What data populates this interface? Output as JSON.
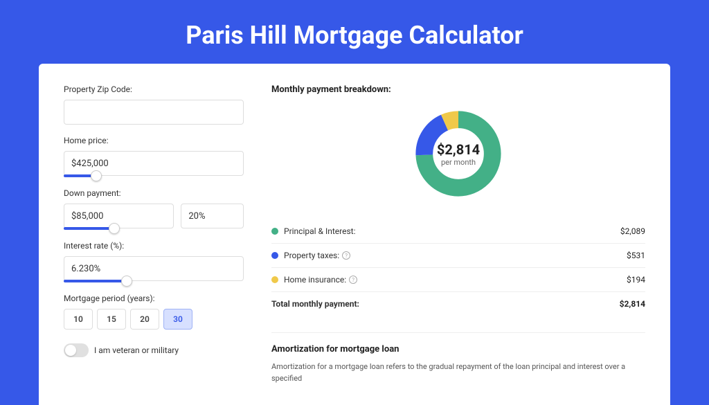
{
  "page_title": "Paris Hill Mortgage Calculator",
  "form": {
    "zip_label": "Property Zip Code:",
    "zip_value": "",
    "home_price_label": "Home price:",
    "home_price_value": "$425,000",
    "down_payment_label": "Down payment:",
    "down_payment_value": "$85,000",
    "down_payment_pct": "20%",
    "interest_label": "Interest rate (%):",
    "interest_value": "6.230%",
    "period_label": "Mortgage period (years):",
    "periods": [
      "10",
      "15",
      "20",
      "30"
    ],
    "period_selected": "30",
    "veteran_label": "I am veteran or military"
  },
  "breakdown": {
    "title": "Monthly payment breakdown:",
    "donut_value": "$2,814",
    "donut_sub": "per month",
    "rows": [
      {
        "color": "#43b087",
        "label": "Principal & Interest:",
        "value": "$2,089"
      },
      {
        "color": "#3658e8",
        "label": "Property taxes:",
        "value": "$531",
        "info": true
      },
      {
        "color": "#f0c94a",
        "label": "Home insurance:",
        "value": "$194",
        "info": true
      }
    ],
    "total_label": "Total monthly payment:",
    "total_value": "$2,814"
  },
  "amort": {
    "title": "Amortization for mortgage loan",
    "text": "Amortization for a mortgage loan refers to the gradual repayment of the loan principal and interest over a specified"
  },
  "chart_data": {
    "type": "pie",
    "title": "Monthly payment breakdown",
    "total": 2814,
    "series": [
      {
        "name": "Principal & Interest",
        "value": 2089,
        "color": "#43b087"
      },
      {
        "name": "Property taxes",
        "value": 531,
        "color": "#3658e8"
      },
      {
        "name": "Home insurance",
        "value": 194,
        "color": "#f0c94a"
      }
    ]
  }
}
